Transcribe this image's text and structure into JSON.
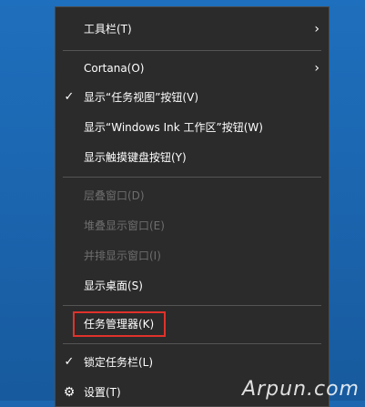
{
  "menu": {
    "items": [
      {
        "label": "工具栏(T)",
        "state": "submenu"
      },
      {
        "label": "Cortana(O)",
        "state": "submenu"
      },
      {
        "label": "显示“任务视图”按钮(V)",
        "state": "checked"
      },
      {
        "label": "显示“Windows Ink 工作区”按钮(W)",
        "state": "normal"
      },
      {
        "label": "显示触摸键盘按钮(Y)",
        "state": "normal"
      },
      {
        "label": "层叠窗口(D)",
        "state": "disabled"
      },
      {
        "label": "堆叠显示窗口(E)",
        "state": "disabled"
      },
      {
        "label": "并排显示窗口(I)",
        "state": "disabled"
      },
      {
        "label": "显示桌面(S)",
        "state": "normal"
      },
      {
        "label": "任务管理器(K)",
        "state": "highlighted"
      },
      {
        "label": "锁定任务栏(L)",
        "state": "checked"
      },
      {
        "label": "设置(T)",
        "state": "gear"
      }
    ],
    "glyphs": {
      "check": "✓",
      "chevron": "›",
      "gear": "⚙"
    }
  },
  "watermark": "Arpun.com",
  "colors": {
    "menu_bg": "#2b2b2b",
    "highlight_border": "#e0322b",
    "desktop": "#1c67b0"
  }
}
